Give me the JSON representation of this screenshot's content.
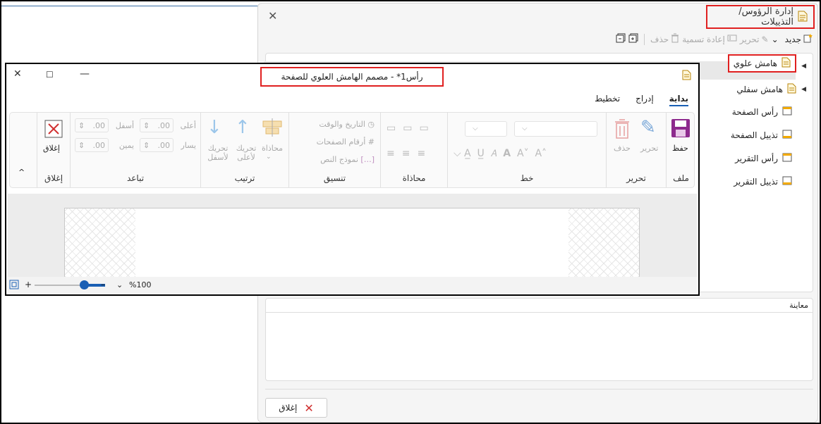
{
  "management": {
    "title": "إدارة الرؤوس/التذييلات",
    "toolbar": {
      "new": "جديد",
      "edit": "تحرير",
      "rename": "إعادة تسمية",
      "delete": "حذف"
    },
    "tree": [
      {
        "label": "هامش علوي",
        "selected": true
      },
      {
        "label": "هامش سفلي"
      },
      {
        "label": "رأس الصفحة"
      },
      {
        "label": "تذييل الصفحة"
      },
      {
        "label": "رأس التقرير"
      },
      {
        "label": "تذييل التقرير"
      }
    ],
    "preview_label": "معاينة",
    "close": "إغلاق"
  },
  "designer": {
    "title": "رأس1* - مصمم الهامش العلوي للصفحة",
    "tabs": [
      "بداية",
      "إدراج",
      "تخطيط"
    ],
    "groups": {
      "file": {
        "label": "ملف",
        "save": "حفظ"
      },
      "edit": {
        "label": "تحرير",
        "edit": "تحرير",
        "delete": "حذف"
      },
      "font": {
        "label": "خط"
      },
      "align": {
        "label": "محاذاة"
      },
      "format": {
        "label": "تنسيق",
        "datetime": "التاريخ والوقت",
        "page_numbers": "أرقام الصفحات",
        "text_form": "نموذج النص"
      },
      "arrange": {
        "label": "ترتيب",
        "align": "محاذاة",
        "move_up": "تحريك لأعلى",
        "move_down": "تحريك لأسفل"
      },
      "spacing": {
        "label": "تباعد",
        "top": "أعلى",
        "bottom": "أسفل",
        "left": "يسار",
        "right": "يمين",
        "v1": ".00",
        "v2": ".00",
        "v3": ".00",
        "v4": ".00"
      },
      "close": {
        "label": "إغلاق",
        "close": "إغلاق"
      }
    },
    "zoom": "%100",
    "zoom_level": 0.72
  },
  "colors": {
    "accent": "#1a5fb4",
    "highlight": "#e02020",
    "save": "#8e2a8e"
  }
}
